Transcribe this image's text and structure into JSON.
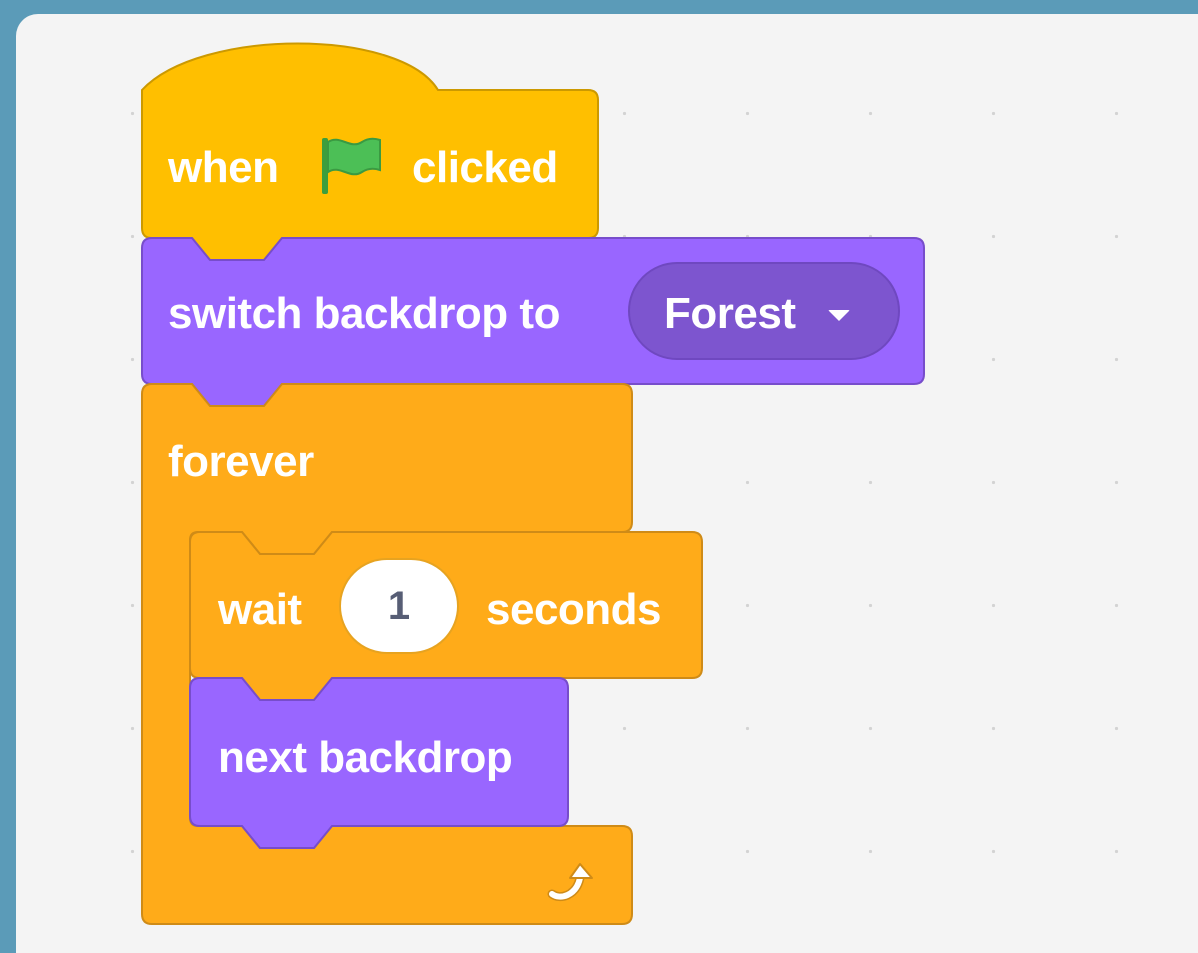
{
  "script": {
    "hat_block": {
      "text_before": "when",
      "icon": "green-flag-icon",
      "text_after": "clicked",
      "color": "#ffbf00"
    },
    "switch_backdrop_block": {
      "label": "switch backdrop to",
      "dropdown_value": "Forest",
      "color": "#9966ff"
    },
    "forever_block": {
      "label": "forever",
      "loop_icon": "loop-arrow-icon",
      "color": "#ffab19"
    },
    "wait_block": {
      "text_before": "wait",
      "input_value": "1",
      "text_after": "seconds",
      "color": "#ffab19"
    },
    "next_backdrop_block": {
      "label": "next backdrop",
      "color": "#9966ff"
    }
  },
  "colors": {
    "page_background": "#5b9bb8",
    "workspace_background": "#f4f4f4",
    "events": "#ffbf00",
    "looks": "#9966ff",
    "control": "#ffab19"
  }
}
